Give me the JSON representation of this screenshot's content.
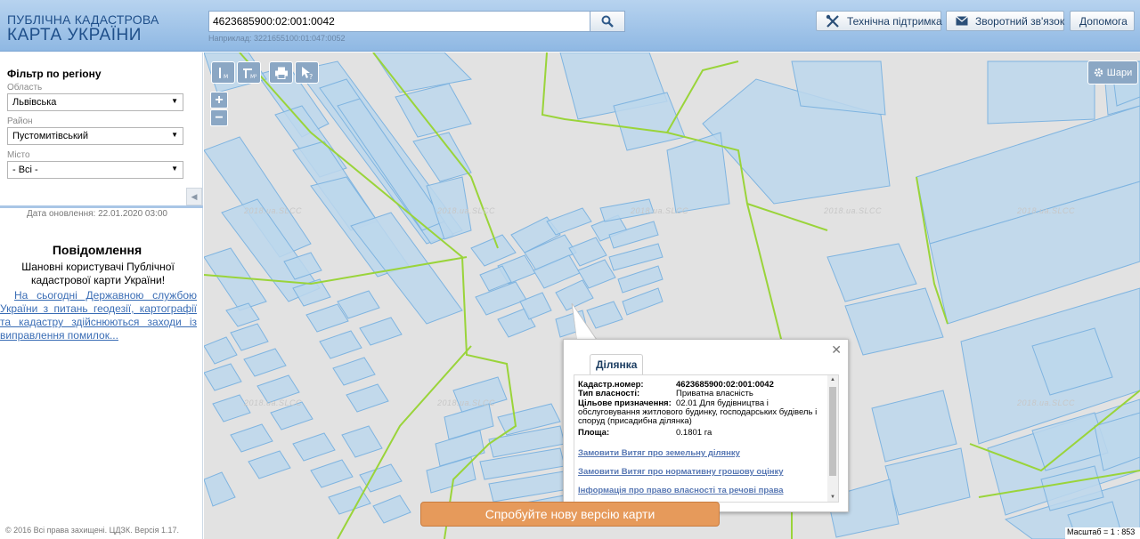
{
  "header": {
    "logo_line1": "ПУБЛІЧНА КАДАСТРОВА",
    "logo_line2": "КАРТА УКРАЇНИ",
    "search_value": "4623685900:02:001:0042",
    "search_hint": "Наприклад: 3221655100:01:047:0052",
    "buttons": {
      "support": "Технічна підтримка",
      "feedback": "Зворотний зв'язок",
      "help": "Допомога"
    }
  },
  "sidebar": {
    "filter_title": "Фільтр по регіону",
    "region_label": "Область",
    "region_value": "Львівська",
    "district_label": "Район",
    "district_value": "Пустомитівський",
    "city_label": "Місто",
    "city_value": "- Всі -",
    "update_date": "Дата оновлення: 22.01.2020 03:00",
    "notice_title": "Повідомлення",
    "notice_greeting": "Шановні користувачі Публічної кадастрової карти України!",
    "notice_link": "На сьогодні Державною службою України з питань геодезії, картографії та кадастру здійснюються заходи із виправлення помилок...",
    "copyright": "© 2016 Всі права захищені. ЦДЗК. Версія 1.17."
  },
  "map": {
    "layers_label": "Шари",
    "watermark": "2018.ua.SLCC",
    "try_new": "Спробуйте нову версію карти",
    "scale": "Масштаб = 1 : 853"
  },
  "popup": {
    "tab": "Ділянка",
    "cadastr_label": "Кадастр.номер:",
    "cadastr_value": "4623685900:02:001:0042",
    "ownership_label": "Тип власності:",
    "ownership_value": "Приватна власність",
    "purpose_label": "Цільове призначення:",
    "purpose_value": "02.01 Для будівництва і обслуговування житлового будинку, господарських будівель і споруд (присадибна ділянка)",
    "area_label": "Площа:",
    "area_value": "0.1801 га",
    "links": {
      "extract_land": "Замовити Витяг про земельну ділянку",
      "extract_valuation": "Замовити Витяг про нормативну грошову оцінку",
      "ownership_info": "Інформація про право власності та речові права"
    }
  },
  "colors": {
    "parcel_fill": "#bcd7ec",
    "parcel_stroke": "#7fb4e0",
    "boundary_green": "#9ad43a",
    "try_button": "#e69a5b"
  }
}
